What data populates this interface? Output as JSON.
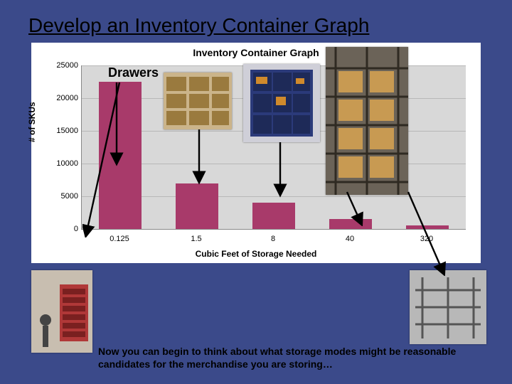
{
  "title": "Develop an Inventory Container Graph",
  "annotation_drawers": "Drawers",
  "caption": "Now you can begin to think about what storage modes might be reasonable candidates for the merchandise you are storing…",
  "chart_data": {
    "type": "bar",
    "title": "Inventory Container Graph",
    "xlabel": "Cubic Feet of Storage Needed",
    "ylabel": "# of SKUs",
    "categories": [
      "0.125",
      "1.5",
      "8",
      "40",
      "320"
    ],
    "values": [
      22500,
      7000,
      4000,
      1500,
      500
    ],
    "ylim": [
      0,
      25000
    ],
    "yticks": [
      0,
      5000,
      10000,
      15000,
      20000,
      25000
    ]
  },
  "photos": {
    "drawers_cabinet": "drawers-cabinet-photo",
    "pallet_stack": "pallet-stack-photo",
    "shelving_unit": "shelving-unit-photo",
    "high_rack": "high-bay-rack-photo",
    "cantilever_rack": "cantilever-rack-photo"
  }
}
